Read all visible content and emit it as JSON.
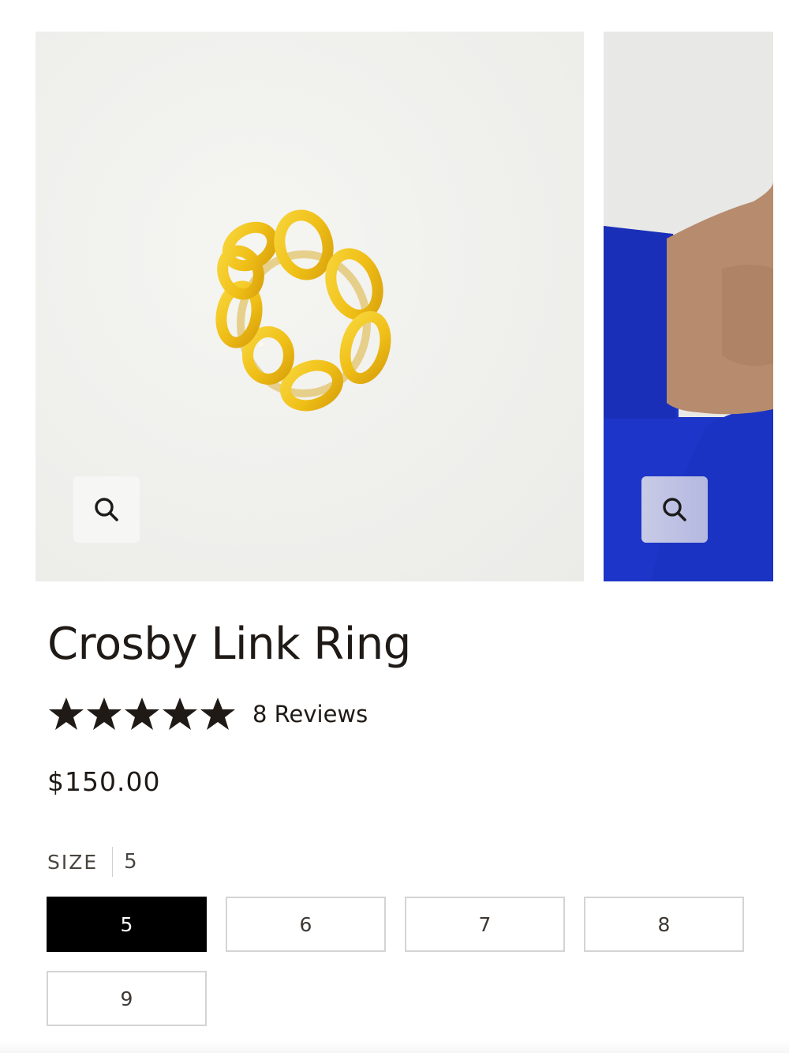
{
  "gallery": {
    "slides": [
      {
        "image": "gold-link-ring-photo",
        "zoom_icon": "search-icon"
      },
      {
        "image": "model-wearing-ring-photo",
        "zoom_icon": "search-icon"
      }
    ]
  },
  "product": {
    "title": "Crosby Link Ring",
    "rating": {
      "stars": 5,
      "max_stars": 5,
      "reviews_label": "8 Reviews"
    },
    "price": "$150.00"
  },
  "size_selector": {
    "label": "SIZE",
    "selected_value": "5",
    "options": [
      "5",
      "6",
      "7",
      "8",
      "9"
    ]
  },
  "colors": {
    "accent": "#000000",
    "text": "#1f1a16",
    "gold": "#f2c21a",
    "sleeve_blue": "#1d35c8",
    "skin": "#b98a6c",
    "border": "#d4d4d4"
  }
}
